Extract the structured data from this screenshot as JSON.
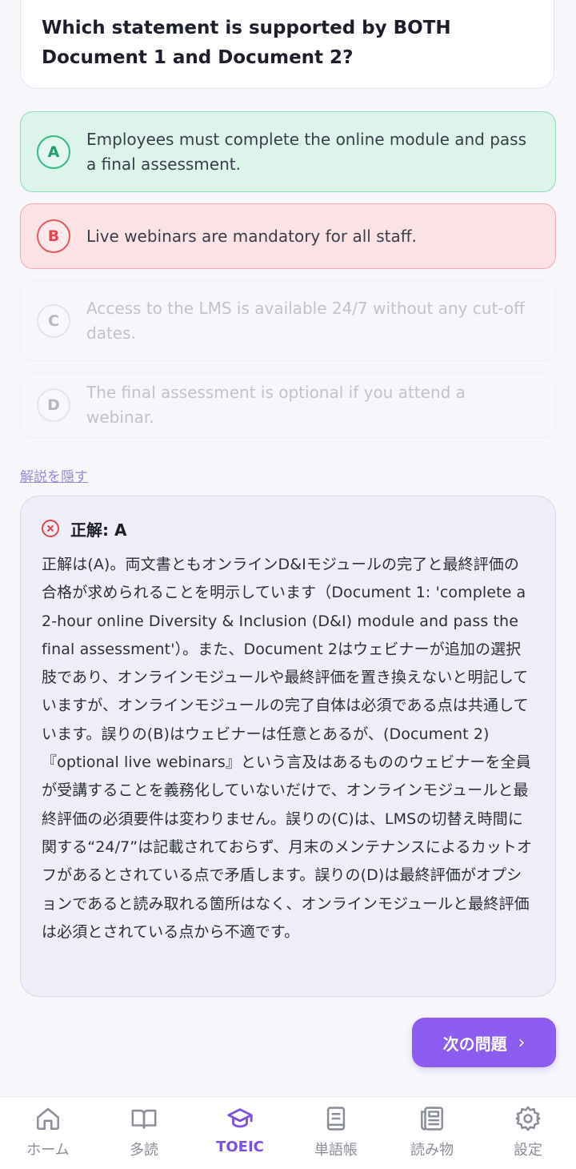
{
  "question": {
    "text": "Which statement is supported by BOTH Document 1 and Document 2?"
  },
  "options": [
    {
      "letter": "A",
      "text": "Employees must complete the online module and pass a final assessment.",
      "state": "correct"
    },
    {
      "letter": "B",
      "text": "Live webinars are mandatory for all staff.",
      "state": "wrong"
    },
    {
      "letter": "C",
      "text": "Access to the LMS is available 24/7 without any cut-off dates.",
      "state": "neutral"
    },
    {
      "letter": "D",
      "text": "The final assessment is optional if you attend a webinar.",
      "state": "neutral"
    }
  ],
  "explanation": {
    "toggle_label": "解説を隠す",
    "title": "正解: A",
    "body": "正解は(A)。両文書ともオンラインD&Iモジュールの完了と最終評価の合格が求められることを明示しています（Document 1: 'complete a 2-hour online Diversity & Inclusion (D&I) module and pass the final assessment'）。また、Document 2はウェビナーが追加の選択肢であり、オンラインモジュールや最終評価を置き換えないと明記していますが、オンラインモジュールの完了自体は必須である点は共通しています。誤りの(B)はウェビナーは任意とあるが、(Document 2)『optional live webinars』という言及はあるもののウェビナーを全員が受講することを義務化していないだけで、オンラインモジュールと最終評価の必須要件は変わりません。誤りの(C)は、LMSの切替え時間に関する“24/7”は記載されておらず、月末のメンテナンスによるカットオフがあるとされている点で矛盾します。誤りの(D)は最終評価がオプションであると読み取れる箇所はなく、オンラインモジュールと最終評価は必須とされている点から不適です。"
  },
  "next_button": {
    "label": "次の問題",
    "chevron": "›"
  },
  "nav": [
    {
      "label": "ホーム",
      "icon": "home-icon"
    },
    {
      "label": "多読",
      "icon": "book-open-icon"
    },
    {
      "label": "TOEIC",
      "icon": "graduation-cap-icon",
      "active": true
    },
    {
      "label": "単語帳",
      "icon": "notebook-icon"
    },
    {
      "label": "読み物",
      "icon": "newspaper-icon"
    },
    {
      "label": "設定",
      "icon": "gear-icon"
    }
  ],
  "colors": {
    "correct": "#35b987",
    "wrong": "#e9575f",
    "accent": "#8c5cf0"
  }
}
